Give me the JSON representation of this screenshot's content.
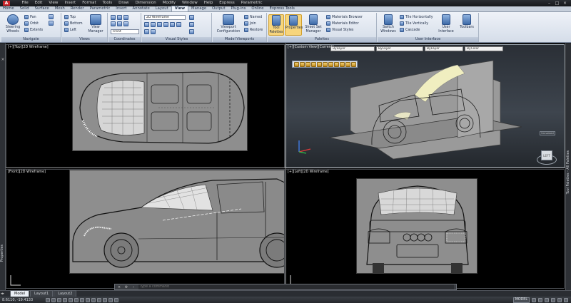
{
  "app": {
    "logo_letter": "A",
    "menus": [
      "File",
      "Edit",
      "View",
      "Insert",
      "Format",
      "Tools",
      "Draw",
      "Dimension",
      "Modify",
      "Window",
      "Help",
      "Express",
      "Parametric"
    ]
  },
  "ribbon": {
    "tabs": [
      "Home",
      "Solid",
      "Surface",
      "Mesh",
      "Render",
      "Parametric",
      "Insert",
      "Annotate",
      "Layout",
      "View",
      "Manage",
      "Output",
      "Plug-ins",
      "Online",
      "Express Tools"
    ],
    "active_tab": "View",
    "panels": {
      "navigate": {
        "title": "Navigate",
        "steering_wheels": "Steering Wheels",
        "pan": "Pan",
        "orbit": "Orbit",
        "extents": "Extents"
      },
      "views": {
        "title": "Views",
        "top": "Top",
        "bottom": "Bottom",
        "left": "Left",
        "view_manager": "View Manager"
      },
      "coordinates": {
        "title": "Coordinates",
        "front": "Front"
      },
      "visual_styles": {
        "title": "Visual Styles",
        "current_style": "2D Wireframe"
      },
      "model_viewports": {
        "title": "Model Viewports",
        "viewport_configuration": "Viewport Configuration",
        "named": "Named",
        "join": "Join",
        "restore": "Restore"
      },
      "palettes": {
        "title": "Palettes",
        "tool_palettes": "Tool Palettes",
        "properties": "Properties",
        "sheet_set_manager": "Sheet Set Manager",
        "materials_browser": "Materials Browser",
        "materials_editor": "Materials Editor",
        "visual_styles": "Visual Styles"
      },
      "user_interface": {
        "title": "User Interface",
        "switch_windows": "Switch Windows",
        "tile_horizontally": "Tile Horizontally",
        "tile_vertically": "Tile Vertically",
        "cascade": "Cascade",
        "user_interface": "User Interface",
        "toolbars": "Toolbars"
      }
    }
  },
  "viewports": {
    "top": {
      "label": "[+][Top][2D Wireframe]"
    },
    "custom": {
      "label": "[+][Custom View][Current]",
      "layer_combo": "ByLayer",
      "linetype_combo": "ByLayer",
      "lineweight_combo": "ByLayer",
      "color_combo": "ByColor",
      "unnamed_tag": "Unnamed",
      "viewcube_face": "LEFT"
    },
    "front": {
      "label": "[Front][2D Wireframe]"
    },
    "left": {
      "label": "[+][Left][2D Wireframe]"
    }
  },
  "side_panels": {
    "left": "Properties",
    "right": "Tool Palettes - All Palettes"
  },
  "command_line": {
    "placeholder": "Type a command"
  },
  "layout_tabs": [
    "Model",
    "Layout1",
    "Layout2"
  ],
  "status": {
    "coordinates": "8.6110, -19.4133",
    "model_label": "MODEL"
  },
  "colors": {
    "accent": "#f7d57c",
    "ribbon_bg": "#dfe6f0",
    "viewport_bg": "#000000",
    "sheet_gray": "#8e8e8e"
  }
}
